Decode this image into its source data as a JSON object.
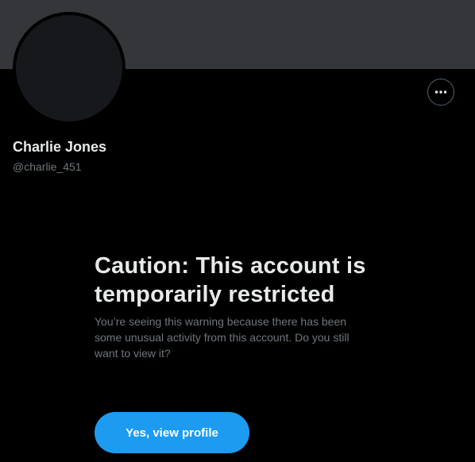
{
  "profile": {
    "display_name": "Charlie Jones",
    "handle": "@charlie_451",
    "more_icon": "more-horizontal-icon"
  },
  "warning": {
    "title": "Caution: This account is temporarily restricted",
    "body": "You’re seeing this warning because there has been some unusual activity from this account. Do you still want to view it?",
    "button_label": "Yes, view profile"
  },
  "colors": {
    "background": "#000000",
    "banner": "#343639",
    "avatar": "#17181c",
    "primary_text": "#e7e9ea",
    "secondary_text": "#71767b",
    "accent": "#1d9bf0"
  }
}
